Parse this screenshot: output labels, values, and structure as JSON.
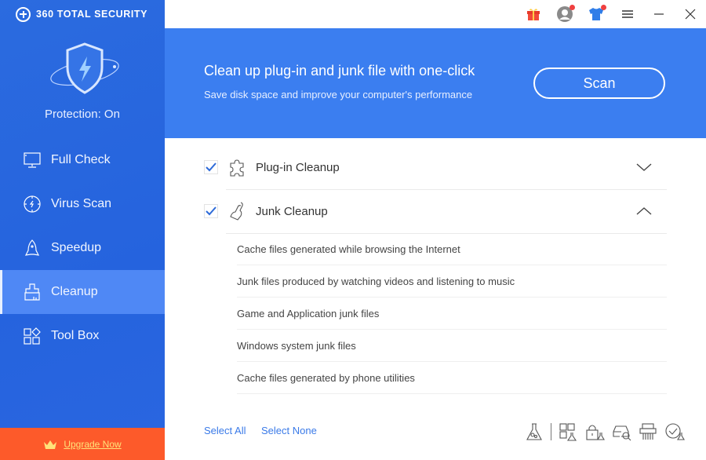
{
  "app": {
    "brand_name": "360 TOTAL SECURITY",
    "protection_status": "Protection: On"
  },
  "sidebar": {
    "items": [
      {
        "label": "Full Check",
        "icon": "monitor-icon"
      },
      {
        "label": "Virus Scan",
        "icon": "virus-scan-icon"
      },
      {
        "label": "Speedup",
        "icon": "rocket-icon"
      },
      {
        "label": "Cleanup",
        "icon": "broom-icon",
        "active": true
      },
      {
        "label": "Tool Box",
        "icon": "toolbox-icon"
      }
    ],
    "upgrade_label": "Upgrade Now"
  },
  "topbar": {
    "icons": [
      "gift-icon",
      "account-icon",
      "skin-icon",
      "menu-icon",
      "minimize-icon",
      "close-icon"
    ]
  },
  "banner": {
    "title": "Clean up plug-in and junk file with one-click",
    "subtitle": "Save disk space and improve your computer's performance",
    "scan_label": "Scan"
  },
  "sections": [
    {
      "label": "Plug-in Cleanup",
      "checked": true,
      "expanded": false
    },
    {
      "label": "Junk Cleanup",
      "checked": true,
      "expanded": true,
      "items": [
        "Cache files generated while browsing the Internet",
        "Junk files produced by watching videos and listening to music",
        "Game and Application junk files",
        "Windows system junk files",
        "Cache files generated by phone utilities"
      ]
    }
  ],
  "footer": {
    "select_all": "Select All",
    "select_none": "Select None",
    "tools": [
      "lab-icon",
      "app-manager-icon",
      "privacy-lock-icon",
      "disk-analyzer-icon",
      "shredder-icon",
      "scheduled-clean-icon"
    ]
  },
  "colors": {
    "sidebar": "#2563de",
    "banner": "#3b7ef0",
    "active": "#4f88f5",
    "upgrade": "#fd5a2a",
    "link": "#3a7ae8"
  }
}
